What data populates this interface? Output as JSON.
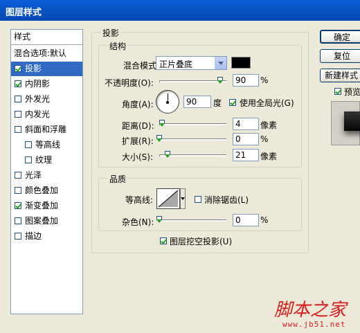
{
  "window": {
    "title": "图层样式"
  },
  "nav": {
    "header": "样式",
    "blend_options": "混合选项:默认",
    "items": [
      {
        "label": "投影",
        "checked": true,
        "selected": true
      },
      {
        "label": "内阴影",
        "checked": true
      },
      {
        "label": "外发光",
        "checked": false
      },
      {
        "label": "内发光",
        "checked": false
      },
      {
        "label": "斜面和浮雕",
        "checked": false
      },
      {
        "label": "等高线",
        "checked": false
      },
      {
        "label": "纹理",
        "checked": false
      },
      {
        "label": "光泽",
        "checked": false
      },
      {
        "label": "颜色叠加",
        "checked": false
      },
      {
        "label": "渐变叠加",
        "checked": true
      },
      {
        "label": "图案叠加",
        "checked": false
      },
      {
        "label": "描边",
        "checked": false
      }
    ]
  },
  "section": {
    "title": "投影"
  },
  "structure": {
    "title": "结构",
    "blend_mode_label": "混合模式:",
    "blend_mode_value": "正片叠底",
    "color": "#000000",
    "opacity_label": "不透明度(O):",
    "opacity_value": "90",
    "opacity_fraction": 0.9,
    "angle_label": "角度(A):",
    "angle_value": "90",
    "angle_unit": "度",
    "global_light_label": "使用全局光(G)",
    "global_light_checked": true,
    "distance_label": "距离(D):",
    "distance_value": "4",
    "distance_unit": "像素",
    "spread_label": "扩展(R):",
    "spread_value": "0",
    "size_label": "大小(S):",
    "size_value": "21",
    "size_unit": "像素",
    "percent_unit": "%"
  },
  "quality": {
    "title": "品质",
    "contour_label": "等高线:",
    "anti_alias_label": "消除锯齿(L)",
    "anti_alias_checked": false,
    "noise_label": "杂色(N):",
    "noise_value": "0",
    "percent_unit": "%",
    "knockout_label": "图层挖空投影(U)",
    "knockout_checked": true
  },
  "buttons": {
    "ok": "确定",
    "reset": "复位",
    "new_style": "新建样式",
    "preview_label": "预览",
    "preview_checked": true
  },
  "watermark": {
    "logo": "脚本之家",
    "url": "www.jb51.net"
  },
  "colors": {
    "selected": "#316ac5",
    "title_bar": "#0754c4",
    "watermark": "#d81c1c"
  }
}
